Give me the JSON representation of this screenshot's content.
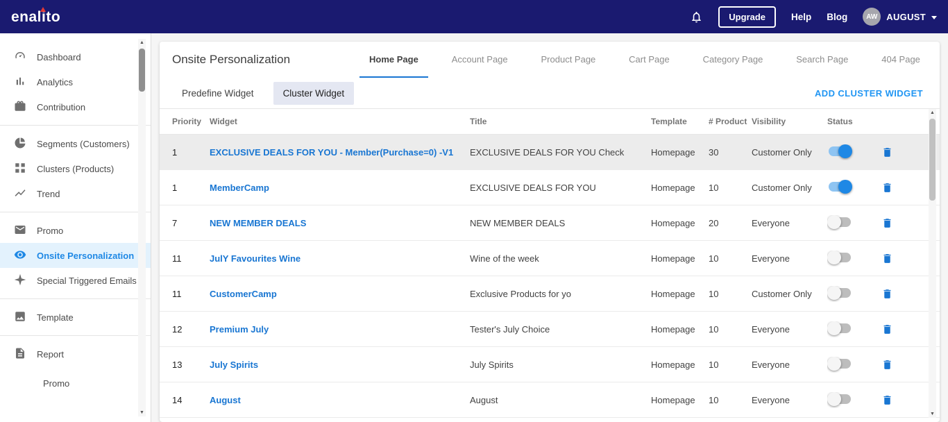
{
  "topbar": {
    "logo": "enalito",
    "upgrade_label": "Upgrade",
    "help_label": "Help",
    "blog_label": "Blog",
    "avatar_initials": "AW",
    "username": "AUGUST"
  },
  "sidebar": {
    "items": [
      {
        "label": "Dashboard",
        "icon": "dashboard-icon"
      },
      {
        "label": "Analytics",
        "icon": "analytics-icon"
      },
      {
        "label": "Contribution",
        "icon": "contribution-icon"
      },
      {
        "label": "Segments (Customers)",
        "icon": "segments-icon"
      },
      {
        "label": "Clusters (Products)",
        "icon": "clusters-icon"
      },
      {
        "label": "Trend",
        "icon": "trend-icon"
      },
      {
        "label": "Promo",
        "icon": "promo-icon"
      },
      {
        "label": "Onsite Personalization",
        "icon": "onsite-personalization-icon",
        "active": true
      },
      {
        "label": "Special Triggered Emails",
        "icon": "triggered-emails-icon"
      },
      {
        "label": "Template",
        "icon": "template-icon"
      },
      {
        "label": "Report",
        "icon": "report-icon"
      },
      {
        "label": "Promo",
        "sub": true
      }
    ]
  },
  "main": {
    "title": "Onsite Personalization",
    "tabs": [
      {
        "label": "Home Page",
        "active": true
      },
      {
        "label": "Account Page"
      },
      {
        "label": "Product Page"
      },
      {
        "label": "Cart Page"
      },
      {
        "label": "Category Page"
      },
      {
        "label": "Search Page"
      },
      {
        "label": "404 Page"
      }
    ],
    "subtabs": [
      {
        "label": "Predefine Widget"
      },
      {
        "label": "Cluster Widget",
        "active": true
      }
    ],
    "add_button": "ADD CLUSTER WIDGET",
    "table": {
      "headers": [
        "Priority",
        "Widget",
        "Title",
        "Template",
        "# Product",
        "Visibility",
        "Status"
      ],
      "rows": [
        {
          "priority": "1",
          "widget": "EXCLUSIVE DEALS FOR YOU - Member(Purchase=0) -V1",
          "title": "EXCLUSIVE DEALS FOR YOU Check",
          "template": "Homepage",
          "product": "30",
          "visibility": "Customer Only",
          "status": true,
          "highlighted": true
        },
        {
          "priority": "1",
          "widget": "MemberCamp",
          "title": "EXCLUSIVE DEALS FOR YOU",
          "template": "Homepage",
          "product": "10",
          "visibility": "Customer Only",
          "status": true
        },
        {
          "priority": "7",
          "widget": "NEW MEMBER DEALS",
          "title": "NEW MEMBER DEALS",
          "template": "Homepage",
          "product": "20",
          "visibility": "Everyone",
          "status": false
        },
        {
          "priority": "11",
          "widget": "JulY Favourites Wine",
          "title": "Wine of the week",
          "template": "Homepage",
          "product": "10",
          "visibility": "Everyone",
          "status": false
        },
        {
          "priority": "11",
          "widget": "CustomerCamp",
          "title": "Exclusive Products for yo",
          "template": "Homepage",
          "product": "10",
          "visibility": "Customer Only",
          "status": false
        },
        {
          "priority": "12",
          "widget": "Premium July",
          "title": "Tester's July Choice",
          "template": "Homepage",
          "product": "10",
          "visibility": "Everyone",
          "status": false
        },
        {
          "priority": "13",
          "widget": "July Spirits",
          "title": "July Spirits",
          "template": "Homepage",
          "product": "10",
          "visibility": "Everyone",
          "status": false
        },
        {
          "priority": "14",
          "widget": "August",
          "title": "August",
          "template": "Homepage",
          "product": "10",
          "visibility": "Everyone",
          "status": false
        }
      ]
    }
  },
  "colors": {
    "topbar_bg": "#1a1a70",
    "accent_blue": "#1e88e5",
    "link_blue": "#1976d2",
    "active_item_bg": "#e3f2fd",
    "logo_accent_red": "#e53935"
  }
}
